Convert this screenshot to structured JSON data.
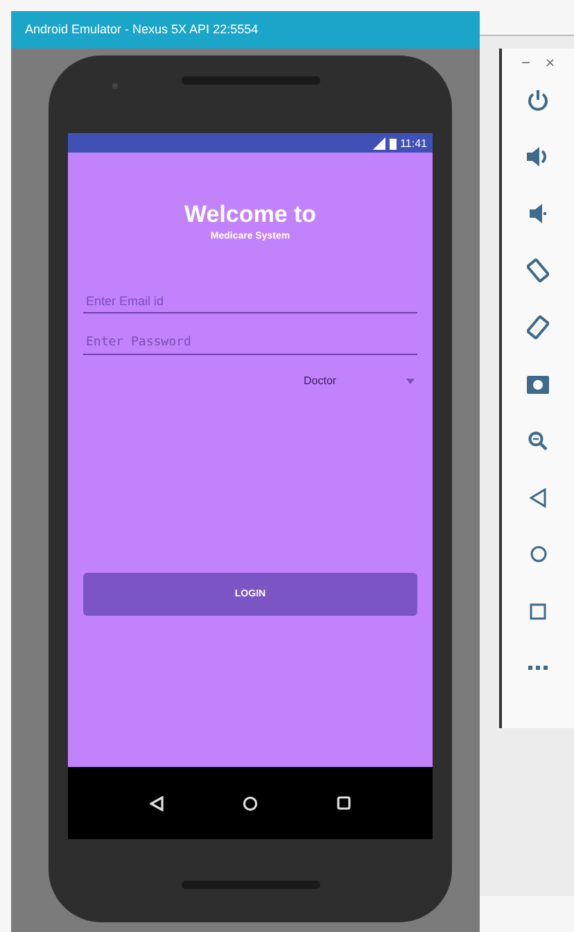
{
  "emulator": {
    "title": "Android Emulator - Nexus 5X API 22:5554"
  },
  "status_bar": {
    "time": "11:41"
  },
  "screen": {
    "title": "Welcome to",
    "subtitle": "Medicare System",
    "email_field": {
      "placeholder": "Enter Email id"
    },
    "password_field": {
      "placeholder": "Enter Password"
    },
    "role_dropdown": {
      "value": "Doctor"
    },
    "login_button": "LOGIN"
  },
  "toolbar": {
    "window_controls": [
      "−",
      "×"
    ],
    "tools": [
      {
        "kind": "power"
      },
      {
        "kind": "volume-up"
      },
      {
        "kind": "volume-down"
      },
      {
        "kind": "rotate-left"
      },
      {
        "kind": "rotate-right"
      },
      {
        "kind": "camera"
      },
      {
        "kind": "zoom"
      },
      {
        "kind": "back"
      },
      {
        "kind": "home"
      },
      {
        "kind": "overview"
      },
      {
        "kind": "more"
      }
    ]
  }
}
